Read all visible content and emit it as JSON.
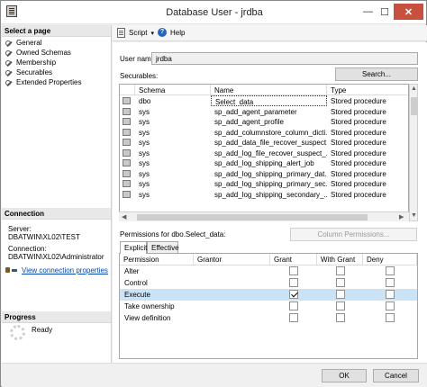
{
  "window": {
    "title": "Database User - jrdba",
    "minimize": "—",
    "maximize": "☐",
    "close": "✕"
  },
  "left_pane": {
    "select_page_header": "Select a page",
    "pages": [
      "General",
      "Owned Schemas",
      "Membership",
      "Securables",
      "Extended Properties"
    ],
    "connection_header": "Connection",
    "server_label": "Server:",
    "server_value": "DBATWIN\\XL02\\TEST",
    "connection_label": "Connection:",
    "connection_value": "DBATWIN\\XL02\\Administrator",
    "view_connection_link": "View connection properties",
    "progress_header": "Progress",
    "progress_status": "Ready"
  },
  "toolbar": {
    "script_label": "Script",
    "script_dropdown": "▾",
    "help_label": "Help"
  },
  "form": {
    "user_name_label": "User name:",
    "user_name_value": "jrdba",
    "securables_label": "Securables:",
    "search_button": "Search...",
    "column_permissions_button": "Column Permissions...",
    "permissions_for_label": "Permissions for dbo.Select_data:"
  },
  "securables_table": {
    "columns": [
      "Schema",
      "Name",
      "Type"
    ],
    "rows": [
      {
        "schema": "dbo",
        "name": "Select_data",
        "type": "Stored procedure"
      },
      {
        "schema": "sys",
        "name": "sp_add_agent_parameter",
        "type": "Stored procedure"
      },
      {
        "schema": "sys",
        "name": "sp_add_agent_profile",
        "type": "Stored procedure"
      },
      {
        "schema": "sys",
        "name": "sp_add_columnstore_column_dicti...",
        "type": "Stored procedure"
      },
      {
        "schema": "sys",
        "name": "sp_add_data_file_recover_suspect...",
        "type": "Stored procedure"
      },
      {
        "schema": "sys",
        "name": "sp_add_log_file_recover_suspect_...",
        "type": "Stored procedure"
      },
      {
        "schema": "sys",
        "name": "sp_add_log_shipping_alert_job",
        "type": "Stored procedure"
      },
      {
        "schema": "sys",
        "name": "sp_add_log_shipping_primary_dat...",
        "type": "Stored procedure"
      },
      {
        "schema": "sys",
        "name": "sp_add_log_shipping_primary_sec...",
        "type": "Stored procedure"
      },
      {
        "schema": "sys",
        "name": "sp_add_log_shipping_secondary_...",
        "type": "Stored procedure"
      }
    ]
  },
  "tabs": [
    "Explicit",
    "Effective"
  ],
  "permissions_table": {
    "columns": [
      "Permission",
      "Grantor",
      "Grant",
      "With Grant",
      "Deny"
    ],
    "rows": [
      {
        "permission": "Alter",
        "grantor": "",
        "grant": false,
        "with_grant": false,
        "deny": false
      },
      {
        "permission": "Control",
        "grantor": "",
        "grant": false,
        "with_grant": false,
        "deny": false
      },
      {
        "permission": "Execute",
        "grantor": "",
        "grant": true,
        "with_grant": false,
        "deny": false
      },
      {
        "permission": "Take ownership",
        "grantor": "",
        "grant": false,
        "with_grant": false,
        "deny": false
      },
      {
        "permission": "View definition",
        "grantor": "",
        "grant": false,
        "with_grant": false,
        "deny": false
      }
    ]
  },
  "buttons": {
    "ok": "OK",
    "cancel": "Cancel"
  }
}
